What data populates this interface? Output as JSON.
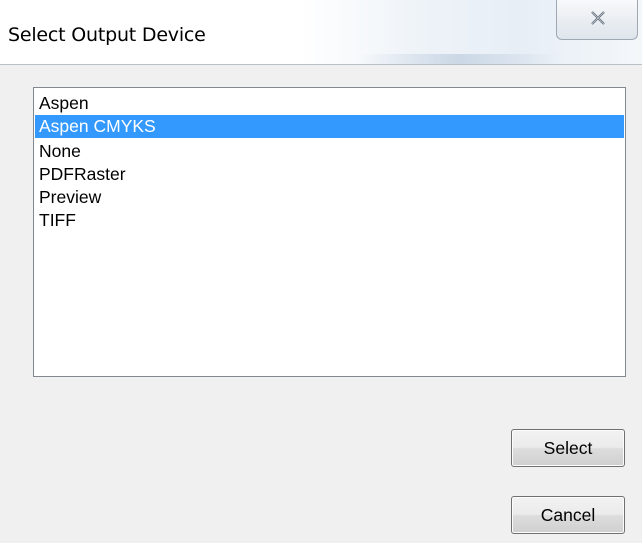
{
  "window": {
    "title": "Select Output Device",
    "close_icon": "close-x-icon"
  },
  "devices": {
    "items": [
      "Aspen",
      "Aspen CMYKS",
      "None",
      "PDFRaster",
      "Preview",
      "TIFF"
    ],
    "selected": "Aspen CMYKS"
  },
  "buttons": {
    "select_label": "Select",
    "cancel_label": "Cancel"
  },
  "colors": {
    "selection_highlight": "#3399ff",
    "dialog_background": "#f0f0f0"
  }
}
